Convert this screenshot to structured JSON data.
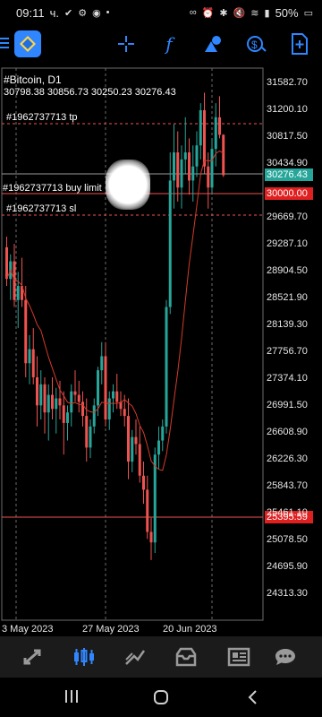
{
  "status_bar": {
    "time": "09:11",
    "carrier_suffix": "ч.",
    "battery": "50%"
  },
  "toolbar": {
    "icons": [
      "menu-icon",
      "metatrader-logo-icon",
      "crosshair-icon",
      "function-icon",
      "objects-icon",
      "timeframe-dollar-icon",
      "new-order-icon"
    ]
  },
  "chart": {
    "symbol": "#Bitcoin, D1",
    "ohlc": "30798.38 30856.73 30250.23 30276.43",
    "orders": {
      "tp": "#1962737713 tp",
      "buy_limit": "#1962737713 buy limit",
      "sl": "#1962737713 sl"
    },
    "price_tags": {
      "current": "30276.43",
      "buy_limit": "30000.00",
      "level": "25395.59"
    },
    "y_ticks": [
      "31582.70",
      "31200.10",
      "30817.50",
      "30434.90",
      "29669.70",
      "29287.10",
      "28904.50",
      "28521.90",
      "28139.30",
      "27756.70",
      "27374.10",
      "26991.50",
      "26608.90",
      "26226.30",
      "25843.70",
      "25461.10",
      "25078.50",
      "24695.90",
      "24313.30"
    ],
    "x_ticks": [
      "3 May 2023",
      "27 May 2023",
      "20 Jun 2023"
    ],
    "colors": {
      "bull": "#26a69a",
      "bear": "#ef5350",
      "ma": "#d23b2a",
      "grid": "#6b6b6b",
      "accent": "#2f86ff"
    }
  },
  "bottom_nav": {
    "items": [
      "quotes-icon",
      "chart-icon",
      "trade-icon",
      "history-icon",
      "news-icon",
      "chat-icon"
    ],
    "active": "chart-icon"
  },
  "system_nav": {
    "items": [
      "recents-icon",
      "home-icon",
      "back-icon"
    ]
  }
}
